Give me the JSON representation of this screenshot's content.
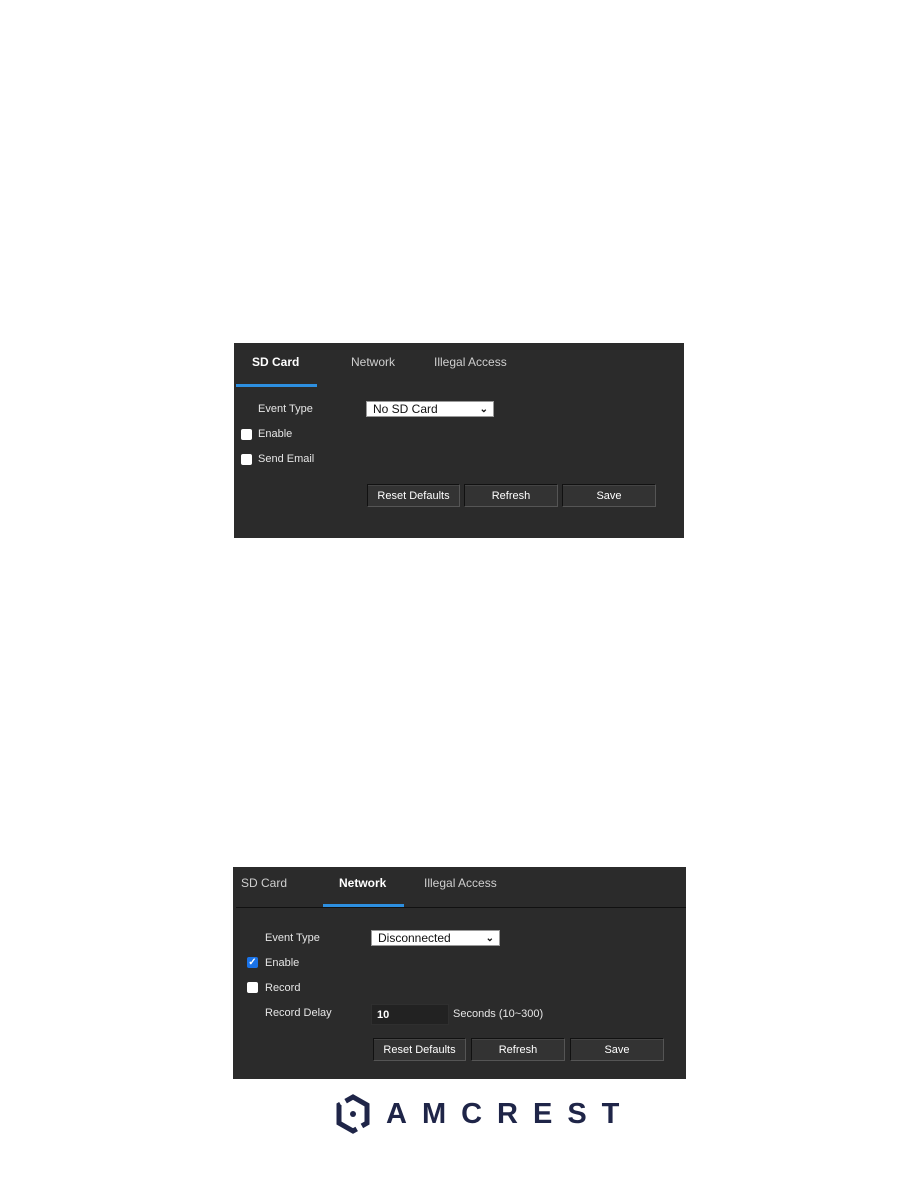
{
  "panel_sd_card": {
    "tabs": [
      {
        "label": "SD Card",
        "active": true
      },
      {
        "label": "Network",
        "active": false
      },
      {
        "label": "Illegal Access",
        "active": false
      }
    ],
    "event_type_label": "Event Type",
    "event_type_value": "No SD Card",
    "enable_label": "Enable",
    "enable_checked": false,
    "send_email_label": "Send Email",
    "send_email_checked": false,
    "buttons": {
      "reset": "Reset Defaults",
      "refresh": "Refresh",
      "save": "Save"
    }
  },
  "panel_network": {
    "tabs": [
      {
        "label": "SD Card",
        "active": false
      },
      {
        "label": "Network",
        "active": true
      },
      {
        "label": "Illegal Access",
        "active": false
      }
    ],
    "event_type_label": "Event Type",
    "event_type_value": "Disconnected",
    "enable_label": "Enable",
    "enable_checked": true,
    "record_label": "Record",
    "record_checked": false,
    "record_delay_label": "Record Delay",
    "record_delay_value": "10",
    "record_delay_unit": "Seconds (10~300)",
    "buttons": {
      "reset": "Reset Defaults",
      "refresh": "Refresh",
      "save": "Save"
    }
  },
  "logo": {
    "text": "AMCREST",
    "color": "#1f2548"
  },
  "colors": {
    "panel_bg": "#2b2b2b",
    "accent": "#2d8fe0"
  }
}
